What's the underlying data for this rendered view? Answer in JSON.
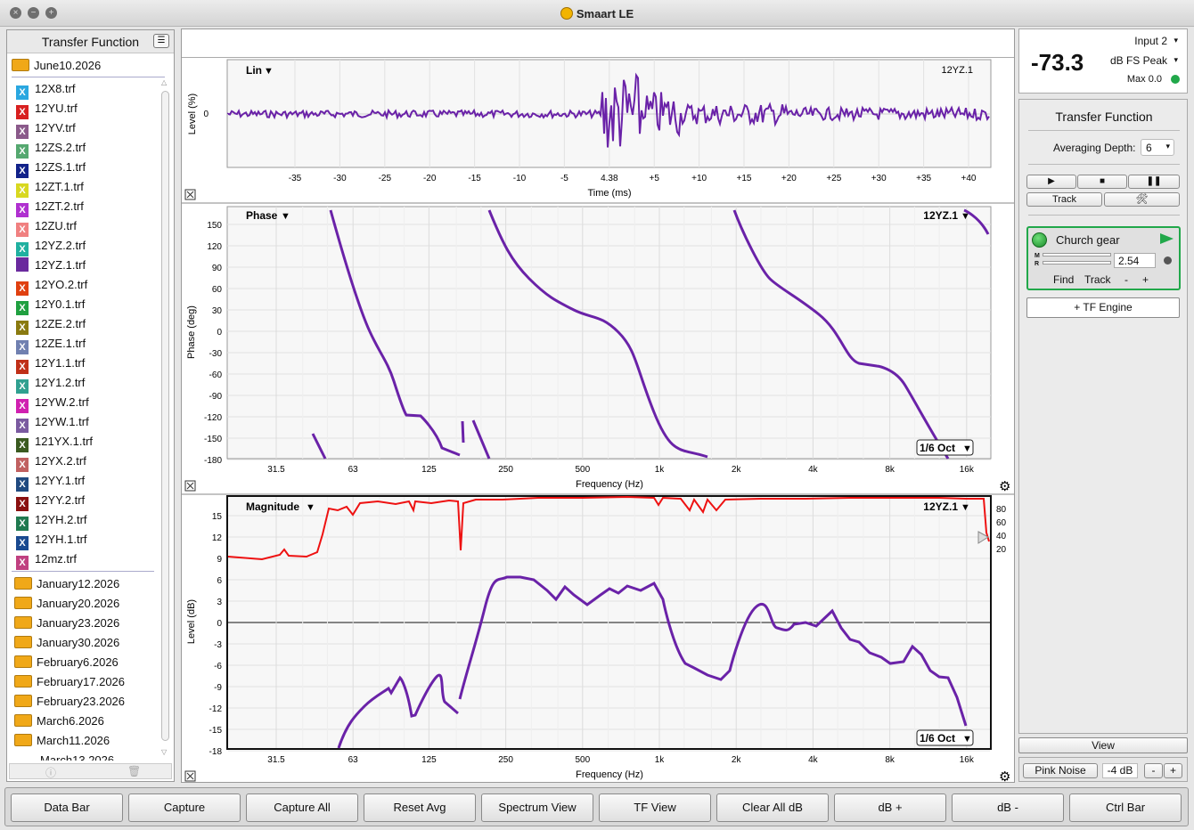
{
  "window": {
    "title": "Smaart LE"
  },
  "sidebar": {
    "header": "Transfer Function",
    "open_folder": "June10.2026",
    "files": [
      {
        "name": "12X8.trf",
        "color": "#2aa7e0"
      },
      {
        "name": "12YU.trf",
        "color": "#d82020"
      },
      {
        "name": "12YV.trf",
        "color": "#8a5a8a"
      },
      {
        "name": "12ZS.2.trf",
        "color": "#55a870"
      },
      {
        "name": "12ZS.1.trf",
        "color": "#12228a"
      },
      {
        "name": "12ZT.1.trf",
        "color": "#d8d820"
      },
      {
        "name": "12ZT.2.trf",
        "color": "#b030d0"
      },
      {
        "name": "12ZU.trf",
        "color": "#f08080"
      },
      {
        "name": "12YZ.2.trf",
        "color": "#20b0a0"
      },
      {
        "name": "12YZ.1.trf",
        "color": "#6a2a9e"
      },
      {
        "name": "12YO.2.trf",
        "color": "#e04010"
      },
      {
        "name": "12Y0.1.trf",
        "color": "#20a040"
      },
      {
        "name": "12ZE.2.trf",
        "color": "#8a7a10"
      },
      {
        "name": "12ZE.1.trf",
        "color": "#7080b0"
      },
      {
        "name": "12Y1.1.trf",
        "color": "#c03018"
      },
      {
        "name": "12Y1.2.trf",
        "color": "#30a090"
      },
      {
        "name": "12YW.2.trf",
        "color": "#d020b0"
      },
      {
        "name": "12YW.1.trf",
        "color": "#7a5aa0"
      },
      {
        "name": "121YX.1.trf",
        "color": "#3a5a20"
      },
      {
        "name": "12YX.2.trf",
        "color": "#c06060"
      },
      {
        "name": "12YY.1.trf",
        "color": "#204a80"
      },
      {
        "name": "12YY.2.trf",
        "color": "#8a1010"
      },
      {
        "name": "12YH.2.trf",
        "color": "#207a50"
      },
      {
        "name": "12YH.1.trf",
        "color": "#1a4a90"
      },
      {
        "name": "12mz.trf",
        "color": "#c04080"
      }
    ],
    "folders": [
      "January12.2026",
      "January20.2026",
      "January23.2026",
      "January30.2026",
      "February6.2026",
      "February17.2026",
      "February23.2026",
      "March6.2026",
      "March11.2026"
    ],
    "folder_partial": "March13.2026"
  },
  "plots": {
    "impulse": {
      "mode": "Lin",
      "trace": "12YZ.1",
      "ylabel": "Level (%)",
      "xlabel": "Time (ms)",
      "ytick": "0",
      "xticks": [
        "-35",
        "-30",
        "-25",
        "-20",
        "-15",
        "-10",
        "-5",
        "4.38",
        "+5",
        "+10",
        "+15",
        "+20",
        "+25",
        "+30",
        "+35",
        "+40"
      ]
    },
    "phase": {
      "mode": "Phase",
      "trace": "12YZ.1",
      "ylabel": "Phase (deg)",
      "xlabel": "Frequency (Hz)",
      "smoothing": "1/6 Oct",
      "yticks": [
        "150",
        "120",
        "90",
        "60",
        "30",
        "0",
        "-30",
        "-60",
        "-90",
        "-120",
        "-150",
        "-180"
      ],
      "xticks": [
        "31.5",
        "63",
        "125",
        "250",
        "500",
        "1k",
        "2k",
        "4k",
        "8k",
        "16k"
      ]
    },
    "magnitude": {
      "mode": "Magnitude",
      "trace": "12YZ.1",
      "ylabel": "Level (dB)",
      "xlabel": "Frequency (Hz)",
      "smoothing": "1/6 Oct",
      "yticks": [
        "15",
        "12",
        "9",
        "6",
        "3",
        "0",
        "-3",
        "-6",
        "-9",
        "-12",
        "-15",
        "-18"
      ],
      "coherence_ticks": [
        "80",
        "60",
        "40",
        "20"
      ],
      "xticks": [
        "31.5",
        "63",
        "125",
        "250",
        "500",
        "1k",
        "2k",
        "4k",
        "8k",
        "16k"
      ]
    }
  },
  "meter": {
    "value": "-73.3",
    "input": "Input 2",
    "unit": "dB FS Peak",
    "max": "Max 0.0"
  },
  "tf_panel": {
    "title": "Transfer Function",
    "averaging_label": "Averaging Depth:",
    "averaging_value": "6",
    "track_label": "Track",
    "engine": {
      "name": "Church gear",
      "delay": "2.54",
      "find": "Find",
      "track": "Track",
      "minus": "-",
      "plus": "+"
    },
    "add_engine": "+ TF Engine"
  },
  "view_label": "View",
  "generator": {
    "label": "Pink Noise",
    "level": "-4 dB",
    "minus": "-",
    "plus": "+"
  },
  "bottom_buttons": [
    "Data Bar",
    "Capture",
    "Capture All",
    "Reset Avg",
    "Spectrum View",
    "TF View",
    "Clear All dB",
    "dB +",
    "dB -",
    "Ctrl Bar"
  ],
  "colors": {
    "trace": "#6a22a8",
    "coherence": "#ee1111",
    "accent_green": "#21a84a"
  }
}
